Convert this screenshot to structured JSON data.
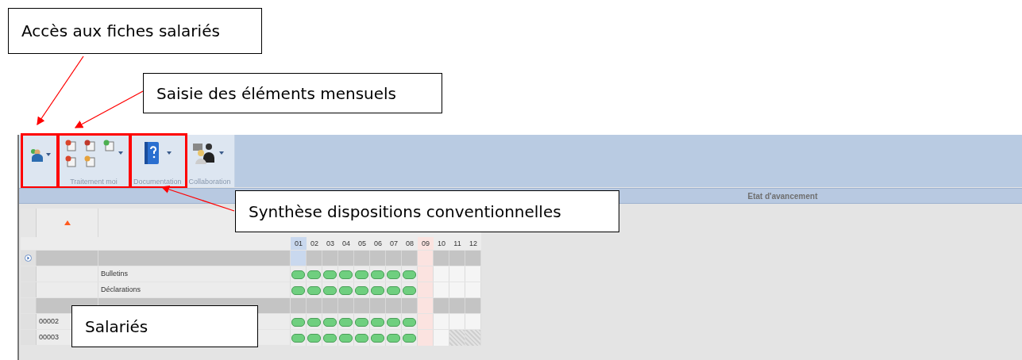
{
  "annotations": [
    {
      "text": "Accès aux fiches salariés"
    },
    {
      "text": "Saisie des éléments mensuels"
    },
    {
      "text": "Synthèse dispositions conventionnelles"
    },
    {
      "text": "Salariés"
    }
  ],
  "ribbon": {
    "groups": [
      {
        "highlighted": true
      },
      {
        "label": "Traitement moi",
        "highlighted": true
      },
      {
        "label": "Documentation",
        "highlighted": true
      },
      {
        "label": "Collaboration",
        "highlighted": false
      }
    ]
  },
  "panel_title": "Etat d'avancement",
  "grid": {
    "sort_ascending": true,
    "months": [
      {
        "label": "01",
        "selected": true,
        "current": false
      },
      {
        "label": "02",
        "selected": false,
        "current": false
      },
      {
        "label": "03",
        "selected": false,
        "current": false
      },
      {
        "label": "04",
        "selected": false,
        "current": false
      },
      {
        "label": "05",
        "selected": false,
        "current": false
      },
      {
        "label": "06",
        "selected": false,
        "current": false
      },
      {
        "label": "07",
        "selected": false,
        "current": false
      },
      {
        "label": "08",
        "selected": false,
        "current": false
      },
      {
        "label": "09",
        "selected": false,
        "current": true
      },
      {
        "label": "10",
        "selected": false,
        "current": false
      },
      {
        "label": "11",
        "selected": false,
        "current": false
      },
      {
        "label": "12",
        "selected": false,
        "current": false
      }
    ],
    "rows": [
      {
        "kind": "group",
        "selected": true
      },
      {
        "kind": "item",
        "selected": false,
        "label": "Bulletins",
        "cells": [
          {
            "kind": "done"
          },
          {
            "kind": "done"
          },
          {
            "kind": "done"
          },
          {
            "kind": "done"
          },
          {
            "kind": "done"
          },
          {
            "kind": "done"
          },
          {
            "kind": "done"
          },
          {
            "kind": "done"
          },
          {
            "kind": "open"
          },
          {
            "kind": "open"
          },
          {
            "kind": "open"
          },
          {
            "kind": "open"
          }
        ]
      },
      {
        "kind": "item",
        "selected": false,
        "label": "Déclarations",
        "cells": [
          {
            "kind": "done"
          },
          {
            "kind": "done"
          },
          {
            "kind": "done"
          },
          {
            "kind": "done"
          },
          {
            "kind": "done"
          },
          {
            "kind": "done"
          },
          {
            "kind": "done"
          },
          {
            "kind": "done"
          },
          {
            "kind": "open"
          },
          {
            "kind": "open"
          },
          {
            "kind": "open"
          },
          {
            "kind": "open"
          }
        ]
      },
      {
        "kind": "group",
        "selected": false
      },
      {
        "kind": "item",
        "selected": false,
        "code": "00002",
        "cells": [
          {
            "kind": "done"
          },
          {
            "kind": "done"
          },
          {
            "kind": "done"
          },
          {
            "kind": "done"
          },
          {
            "kind": "done"
          },
          {
            "kind": "done"
          },
          {
            "kind": "done"
          },
          {
            "kind": "done"
          },
          {
            "kind": "open"
          },
          {
            "kind": "open"
          },
          {
            "kind": "open"
          },
          {
            "kind": "open"
          }
        ]
      },
      {
        "kind": "item",
        "selected": false,
        "code": "00003",
        "cells": [
          {
            "kind": "done"
          },
          {
            "kind": "done"
          },
          {
            "kind": "done"
          },
          {
            "kind": "done"
          },
          {
            "kind": "done"
          },
          {
            "kind": "done"
          },
          {
            "kind": "done"
          },
          {
            "kind": "done"
          },
          {
            "kind": "open"
          },
          {
            "kind": "open"
          },
          {
            "kind": "hatched"
          },
          {
            "kind": "hatched"
          }
        ]
      }
    ]
  }
}
